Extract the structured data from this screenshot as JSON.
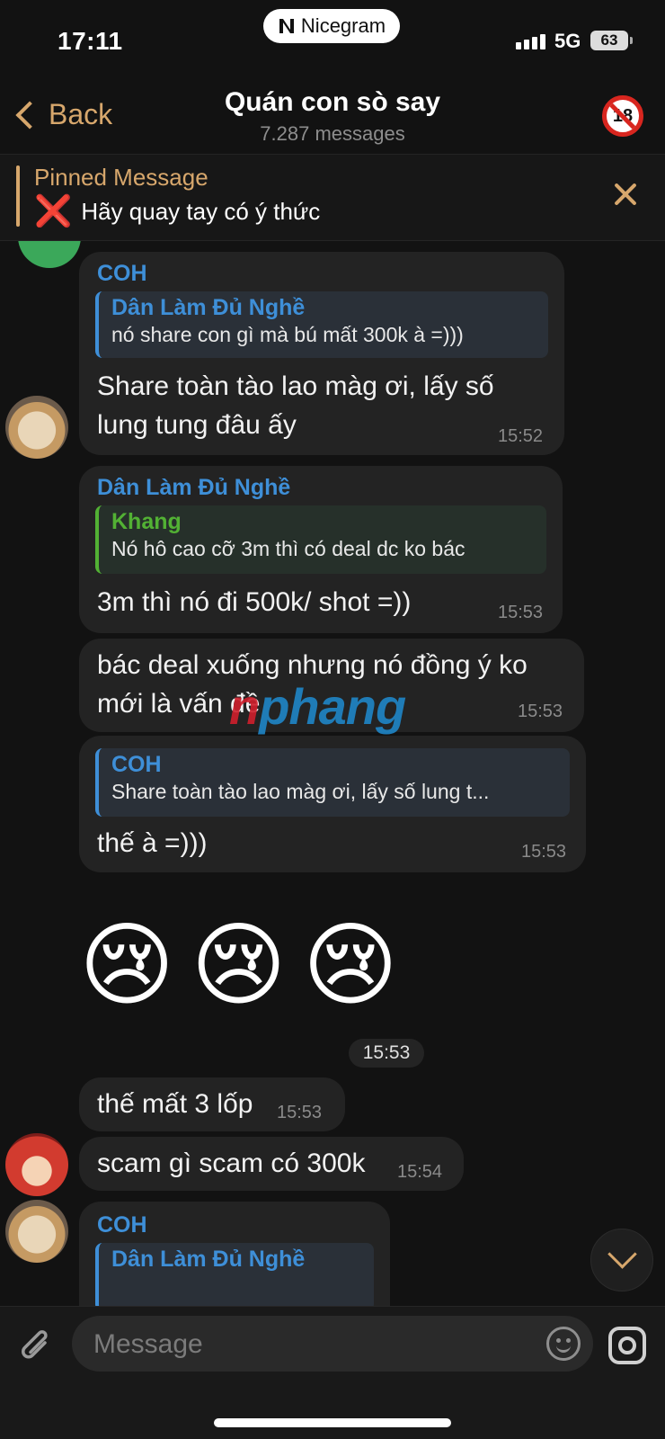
{
  "status_bar": {
    "time": "17:11",
    "app_pill": "Nicegram",
    "network": "5G",
    "battery": "63"
  },
  "nav": {
    "back_label": "Back",
    "title": "Quán con sò say",
    "subtitle": "7.287 messages",
    "age_badge": "18"
  },
  "pinned": {
    "label": "Pinned Message",
    "icon": "❌",
    "text": "Hãy quay tay có ý thức"
  },
  "messages": [
    {
      "sender": "COH",
      "reply_name": "Dân Làm Đủ Nghề",
      "reply_text": "nó share con gì mà bú mất 300k à =)))",
      "text_lines": [
        "Share toàn tào lao màg ơi, lấy số",
        "lung tung đâu ấy"
      ],
      "time": "15:52"
    },
    {
      "sender": "Dân Làm Đủ Nghề",
      "reply_name": "Khang",
      "reply_text": "Nó hô cao cỡ 3m thì có deal dc ko bác",
      "text": "3m thì nó đi 500k/ shot =))",
      "time": "15:53"
    },
    {
      "text_lines": [
        "bác deal xuống nhưng nó đồng ý ko",
        "mới là vấn đề"
      ],
      "time": "15:53"
    },
    {
      "reply_name": "COH",
      "reply_text": "Share toàn tào lao màg ơi, lấy số lung t...",
      "text": "thế à =)))",
      "time": "15:53"
    },
    {
      "emoji": [
        "😢",
        "😢",
        "😢"
      ]
    },
    {
      "chip_time": "15:53"
    },
    {
      "text": "thế mất 3 lốp",
      "time": "15:53"
    },
    {
      "text": "scam gì scam có 300k",
      "time": "15:54"
    },
    {
      "sender": "COH",
      "reply_name": "Dân Làm Đủ Nghề"
    }
  ],
  "watermark": {
    "red": "n",
    "blue": "phang"
  },
  "composer": {
    "placeholder": "Message"
  },
  "colors": {
    "accent": "#d7a76c",
    "sender_blue": "#3e8fd8",
    "reply_green": "#52b134",
    "bubble": "#232323",
    "background": "#121212"
  },
  "icons": [
    "chevron-left-icon",
    "no-18-icon",
    "close-icon",
    "paperclip-icon",
    "emoji-icon",
    "instagram-icon",
    "chevron-down-icon"
  ]
}
